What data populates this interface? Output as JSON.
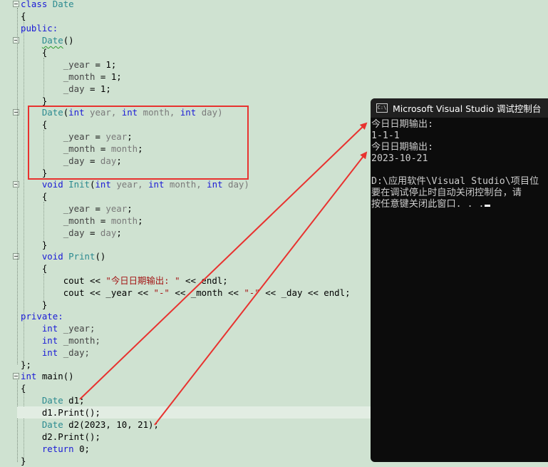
{
  "editor": {
    "class_kw": "class",
    "class_name": "Date",
    "open_brace": "{",
    "close_brace": "}",
    "class_close": "};",
    "public_label": "public:",
    "private_label": "private:",
    "ctor_default": {
      "name": "Date",
      "params": "()"
    },
    "assign_const": [
      {
        "member": "_year",
        "rest": " = 1;"
      },
      {
        "member": "_month",
        "rest": " = 1;"
      },
      {
        "member": "_day",
        "rest": " = 1;"
      }
    ],
    "ctor_params": {
      "name": "Date",
      "sig": [
        "(",
        "int",
        " year, ",
        "int",
        " month, ",
        "int",
        " day)"
      ]
    },
    "assign_params": [
      {
        "member": "_year",
        "eq": " = ",
        "param": "year",
        "end": ";"
      },
      {
        "member": "_month",
        "eq": " = ",
        "param": "month",
        "end": ";"
      },
      {
        "member": "_day",
        "eq": " = ",
        "param": "day",
        "end": ";"
      }
    ],
    "init_fn": {
      "ret": "void",
      "name": "Init",
      "sig": [
        "(",
        "int",
        " year, ",
        "int",
        " month, ",
        "int",
        " day)"
      ]
    },
    "print_fn": {
      "ret": "void",
      "name": "Print",
      "params": "()"
    },
    "print_body": [
      {
        "a": "cout << ",
        "s": "\"今日日期输出: \"",
        "b": " << endl;"
      },
      {
        "a": "cout << _year << ",
        "s": "\"-\"",
        "b": " << _month << ",
        "s2": "\"-\"",
        "c": " << _day << endl;"
      }
    ],
    "fields": [
      {
        "type": "int",
        "name": " _year;"
      },
      {
        "type": "int",
        "name": " _month;"
      },
      {
        "type": "int",
        "name": " _day;"
      }
    ],
    "main_fn": {
      "ret": "int",
      "name": " main()"
    },
    "main_body": [
      {
        "type": "Date",
        "rest": " d1;"
      },
      {
        "obj": "d1",
        "rest": ".Print();"
      },
      {
        "type": "Date",
        "rest": " d2(2023, 10, 21);"
      },
      {
        "obj": "d2",
        "rest": ".Print();"
      },
      {
        "kw": "return",
        "rest": " 0;"
      }
    ]
  },
  "console": {
    "title": "Microsoft Visual Studio 调试控制台",
    "icon_text": "C:\\",
    "lines": [
      "今日日期输出:",
      "1-1-1",
      "今日日期输出:",
      "2023-10-21",
      "",
      "D:\\应用软件\\Visual Studio\\项目位",
      "要在调试停止时自动关闭控制台，请",
      "按任意键关闭此窗口. . ."
    ]
  },
  "colors": {
    "background": "#cfe2d1",
    "keyword": "#1a1ad6",
    "annotation_red": "#e8322f",
    "console_bg": "#0c0c0c"
  }
}
